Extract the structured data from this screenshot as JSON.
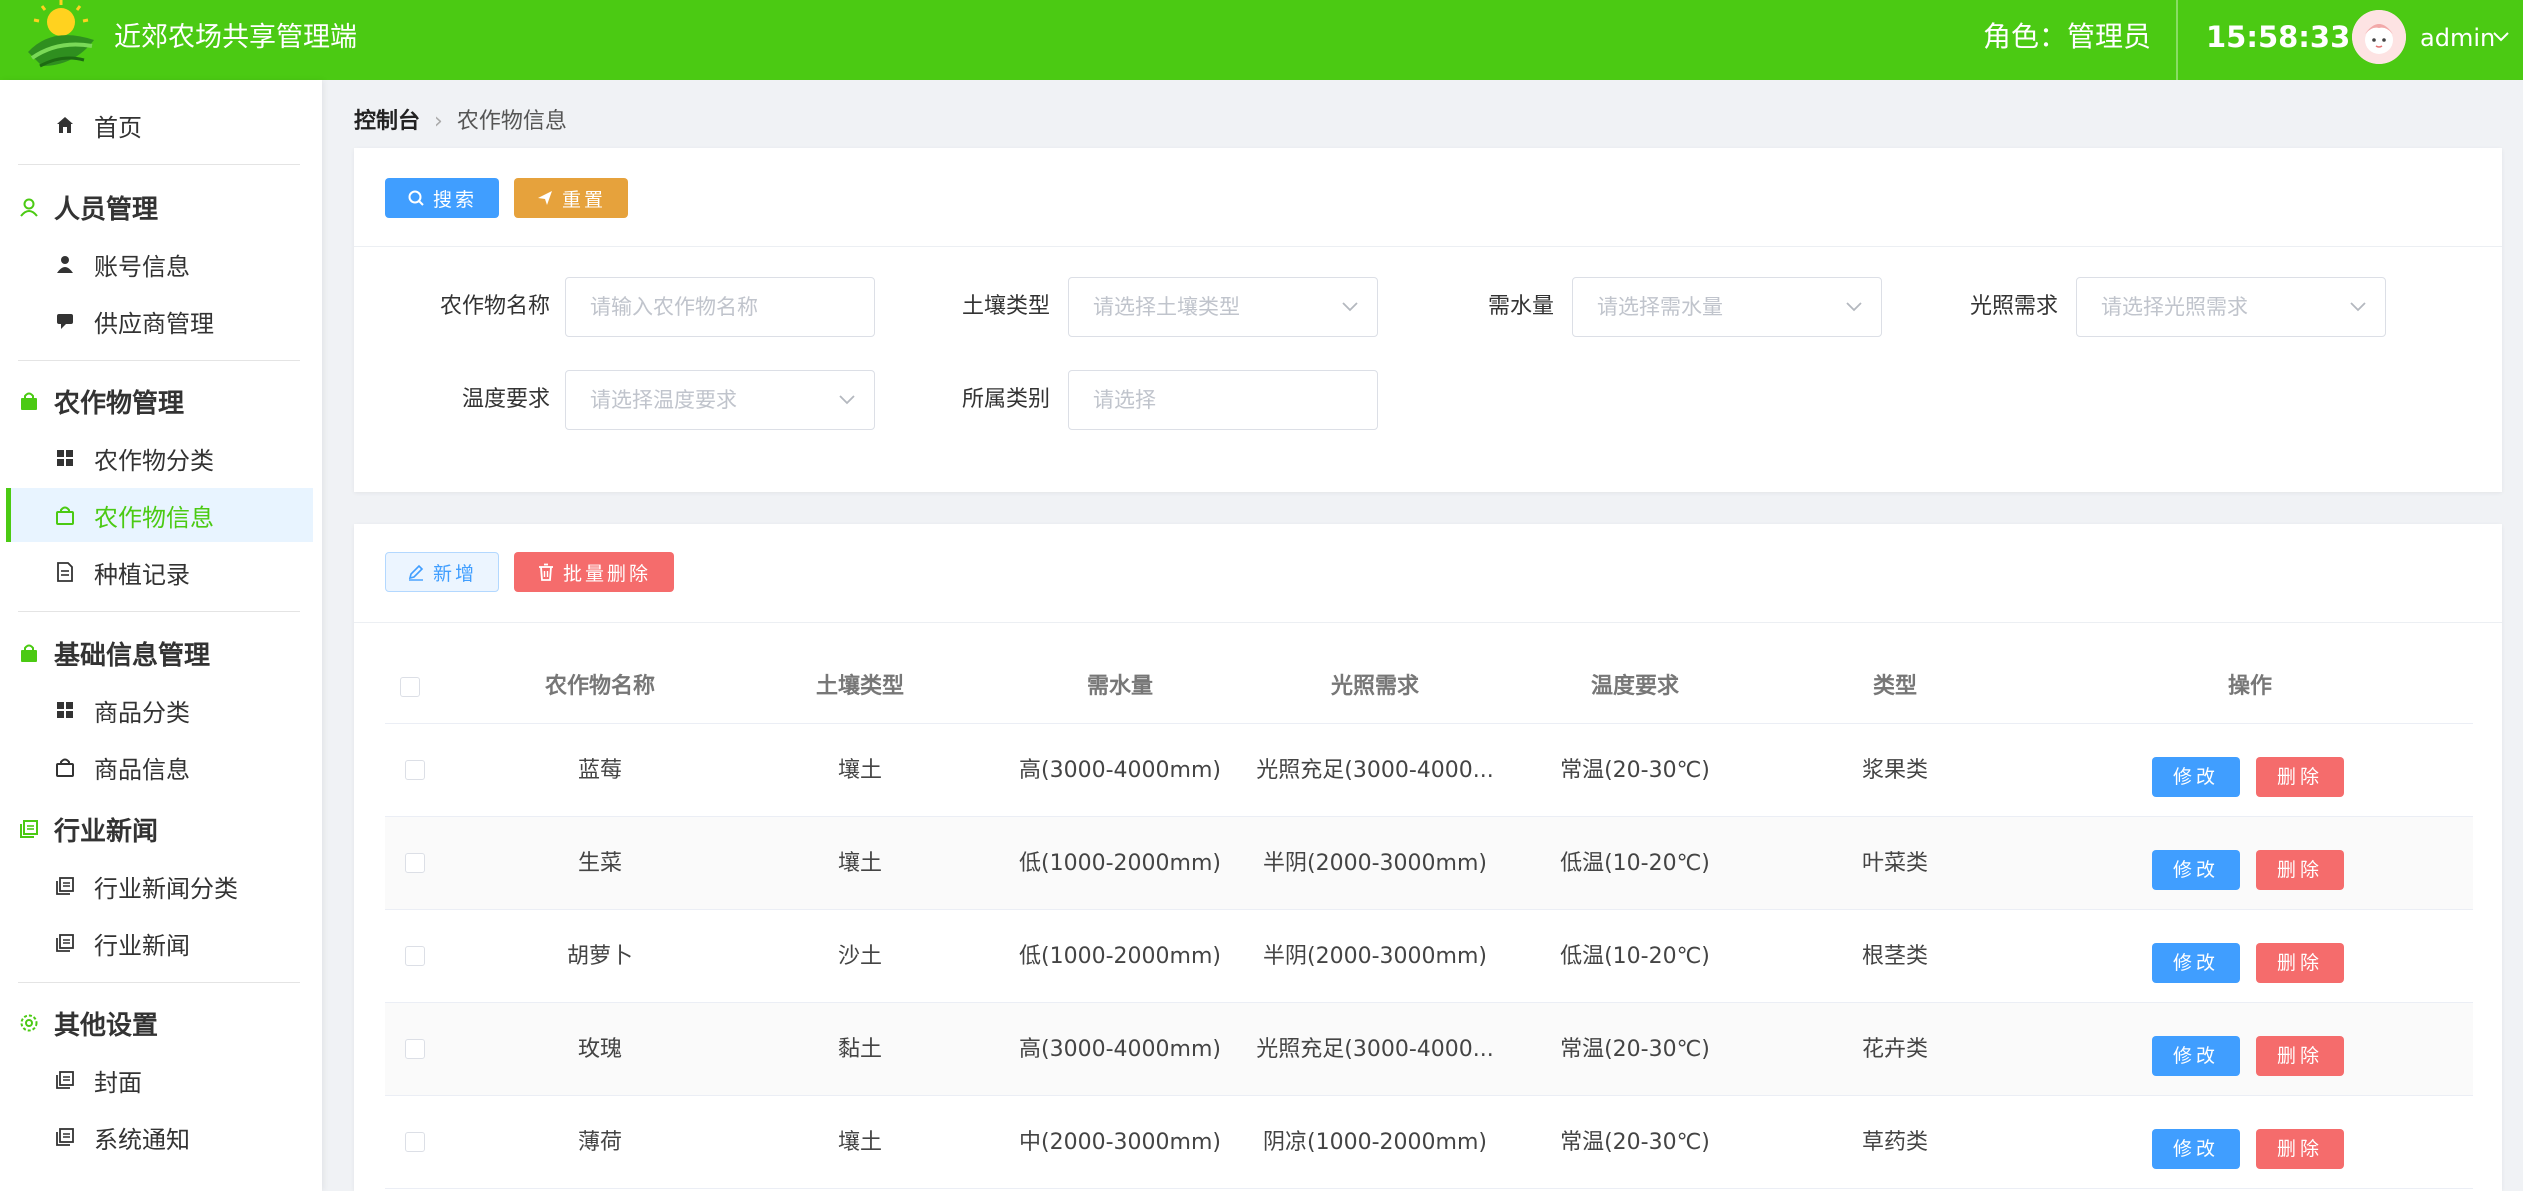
{
  "header": {
    "title": "近郊农场共享管理端",
    "role": "角色：管理员",
    "time": "15:58:33",
    "username": "admin",
    "bg_color": "#4bca13"
  },
  "sidebar": {
    "home": "首页",
    "groups": [
      {
        "label": "人员管理",
        "icon": "user-icon",
        "items": [
          {
            "label": "账号信息",
            "icon": "person-icon"
          },
          {
            "label": "供应商管理",
            "icon": "chat-icon"
          }
        ]
      },
      {
        "label": "农作物管理",
        "icon": "bag-icon",
        "items": [
          {
            "label": "农作物分类",
            "icon": "grid-icon"
          },
          {
            "label": "农作物信息",
            "icon": "bag-outline-icon",
            "active": true
          },
          {
            "label": "种植记录",
            "icon": "document-icon"
          }
        ]
      },
      {
        "label": "基础信息管理",
        "icon": "bag-icon",
        "items": [
          {
            "label": "商品分类",
            "icon": "grid-icon"
          },
          {
            "label": "商品信息",
            "icon": "bag-outline-icon"
          }
        ]
      },
      {
        "label": "行业新闻",
        "icon": "copy-icon",
        "items": [
          {
            "label": "行业新闻分类",
            "icon": "copy-icon"
          },
          {
            "label": "行业新闻",
            "icon": "copy-icon"
          }
        ]
      },
      {
        "label": "其他设置",
        "icon": "gear-icon",
        "items": [
          {
            "label": "封面",
            "icon": "copy-icon"
          },
          {
            "label": "系统通知",
            "icon": "copy-icon"
          }
        ]
      }
    ]
  },
  "breadcrumb": {
    "root": "控制台",
    "current": "农作物信息"
  },
  "search": {
    "search_btn": "搜索",
    "reset_btn": "重置",
    "fields": [
      {
        "label": "农作物名称",
        "placeholder": "请输入农作物名称",
        "select": false
      },
      {
        "label": "土壤类型",
        "placeholder": "请选择土壤类型",
        "select": true
      },
      {
        "label": "需水量",
        "placeholder": "请选择需水量",
        "select": true
      },
      {
        "label": "光照需求",
        "placeholder": "请选择光照需求",
        "select": true
      },
      {
        "label": "温度要求",
        "placeholder": "请选择温度要求",
        "select": true
      },
      {
        "label": "所属类别",
        "placeholder": "请选择",
        "select": false
      }
    ]
  },
  "toolbar": {
    "add_btn": "新增",
    "batch_delete_btn": "批量删除"
  },
  "table": {
    "columns": [
      "农作物名称",
      "土壤类型",
      "需水量",
      "光照需求",
      "温度要求",
      "类型",
      "操作"
    ],
    "edit_label": "修改",
    "delete_label": "删除",
    "rows": [
      [
        "蓝莓",
        "壤土",
        "高(3000-4000mm)",
        "光照充足(3000-4000...",
        "常温(20-30℃)",
        "浆果类"
      ],
      [
        "生菜",
        "壤土",
        "低(1000-2000mm)",
        "半阴(2000-3000mm)",
        "低温(10-20℃)",
        "叶菜类"
      ],
      [
        "胡萝卜",
        "沙土",
        "低(1000-2000mm)",
        "半阴(2000-3000mm)",
        "低温(10-20℃)",
        "根茎类"
      ],
      [
        "玫瑰",
        "黏土",
        "高(3000-4000mm)",
        "光照充足(3000-4000...",
        "常温(20-30℃)",
        "花卉类"
      ],
      [
        "薄荷",
        "壤土",
        "中(2000-3000mm)",
        "阴凉(1000-2000mm)",
        "常温(20-30℃)",
        "草药类"
      ]
    ]
  }
}
